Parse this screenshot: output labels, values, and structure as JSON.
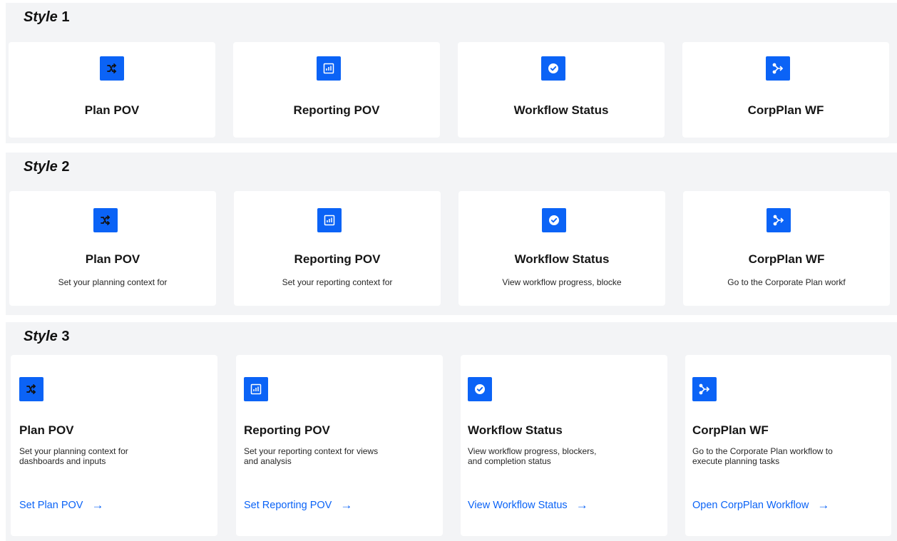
{
  "sections": [
    {
      "prefix": "Style",
      "number": "1"
    },
    {
      "prefix": "Style",
      "number": "2"
    },
    {
      "prefix": "Style",
      "number": "3"
    }
  ],
  "cards": [
    {
      "icon": "shuffle-icon",
      "title": "Plan POV",
      "short_desc": "Set your planning context for",
      "desc_line1": "Set your planning context for",
      "desc_line2": "dashboards and inputs",
      "link": "Set Plan POV"
    },
    {
      "icon": "bar-chart-icon",
      "title": "Reporting POV",
      "short_desc": "Set your reporting context for",
      "desc_line1": "Set your reporting context for views",
      "desc_line2": "and analysis",
      "link": "Set Reporting POV"
    },
    {
      "icon": "check-circle-icon",
      "title": "Workflow Status",
      "short_desc": "View workflow progress, blocke",
      "desc_line1": "View workflow progress, blockers,",
      "desc_line2": "and completion status",
      "link": "View Workflow Status"
    },
    {
      "icon": "flow-icon",
      "title": "CorpPlan WF",
      "short_desc": "Go to the Corporate Plan workf",
      "desc_line1": "Go to the Corporate Plan workflow to",
      "desc_line2": "execute planning tasks",
      "link": "Open CorpPlan Workflow"
    }
  ],
  "arrow_glyph": "→",
  "colors": {
    "accent": "#0b63f6",
    "section_bg": "#f3f4f6",
    "card_bg": "#ffffff"
  }
}
